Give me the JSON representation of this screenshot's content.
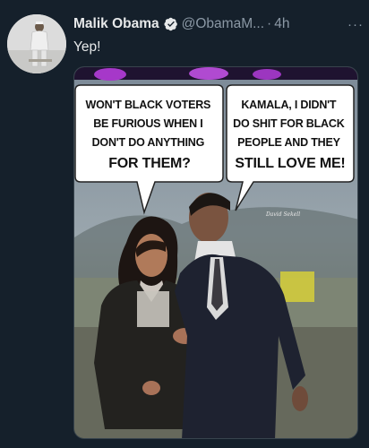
{
  "tweet": {
    "author_name": "Malik Obama",
    "handle": "@ObamaM...",
    "separator": "·",
    "time": "4h",
    "more": "···",
    "text": "Yep!",
    "verified": true
  },
  "meme": {
    "left_bubble": [
      "WON'T BLACK VOTERS",
      "BE FURIOUS WHEN I",
      "DON'T DO ANYTHING",
      "FOR THEM?"
    ],
    "right_bubble": [
      "KAMALA, I DIDN'T",
      "DO SHIT FOR BLACK",
      "PEOPLE AND THEY",
      "STILL LOVE ME!"
    ],
    "watermark": "David Sekell"
  },
  "colors": {
    "background": "#15202b",
    "text_primary": "#e7e9ea",
    "text_secondary": "#8b98a5",
    "verified_badge": "#e7e9ea"
  },
  "icons": {
    "verified": "verified-badge-icon",
    "more": "more-options-icon"
  }
}
